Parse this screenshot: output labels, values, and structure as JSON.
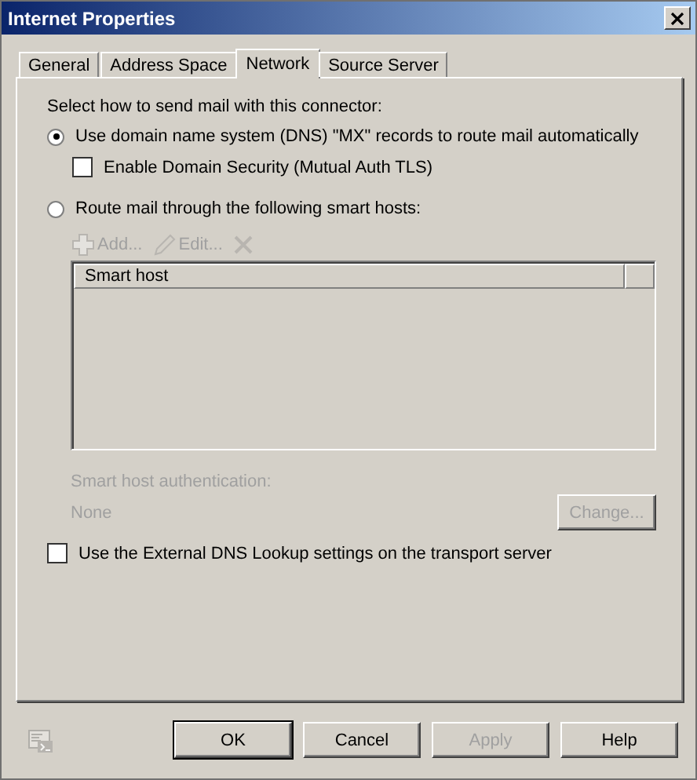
{
  "window": {
    "title": "Internet Properties"
  },
  "tabs": [
    {
      "label": "General",
      "selected": false
    },
    {
      "label": "Address Space",
      "selected": false
    },
    {
      "label": "Network",
      "selected": true
    },
    {
      "label": "Source Server",
      "selected": false
    }
  ],
  "section_label": "Select how to send mail with this connector:",
  "dns_option": {
    "label": "Use domain name system (DNS) \"MX\" records to route mail automatically",
    "selected": true
  },
  "domain_security": {
    "label": "Enable Domain Security (Mutual Auth TLS)",
    "checked": false
  },
  "smart_host_option": {
    "label": "Route mail through the following smart hosts:",
    "selected": false
  },
  "toolbar": [
    {
      "kind": "add",
      "label": "Add...",
      "disabled": true
    },
    {
      "kind": "edit",
      "label": "Edit...",
      "disabled": true
    },
    {
      "kind": "remove",
      "disabled": true
    }
  ],
  "table": {
    "columns": [
      "Smart host"
    ]
  },
  "authentication": {
    "label": "Smart host authentication:",
    "value": "None",
    "button": "Change...",
    "disabled": true
  },
  "external_dns": {
    "label": "Use the External DNS Lookup settings on the transport server",
    "checked": false
  },
  "buttons": [
    {
      "label": "OK",
      "default": true,
      "disabled": false
    },
    {
      "label": "Cancel",
      "default": false,
      "disabled": false
    },
    {
      "label": "Apply",
      "default": false,
      "disabled": true
    },
    {
      "label": "Help",
      "default": false,
      "disabled": false
    }
  ]
}
